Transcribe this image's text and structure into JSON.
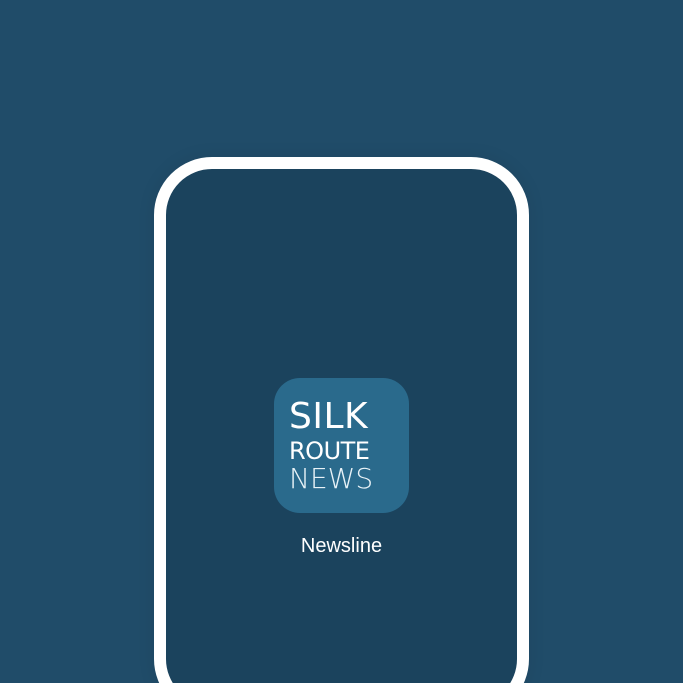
{
  "app": {
    "logo_line_1": "SILK",
    "logo_line_2": "ROUTE",
    "logo_line_3": "NEWS",
    "name": "Newsline"
  },
  "colors": {
    "background": "#204c69",
    "phone_screen": "#1b435d",
    "phone_frame": "#ffffff",
    "app_tile": "#2a6a8c",
    "text": "#ffffff"
  }
}
